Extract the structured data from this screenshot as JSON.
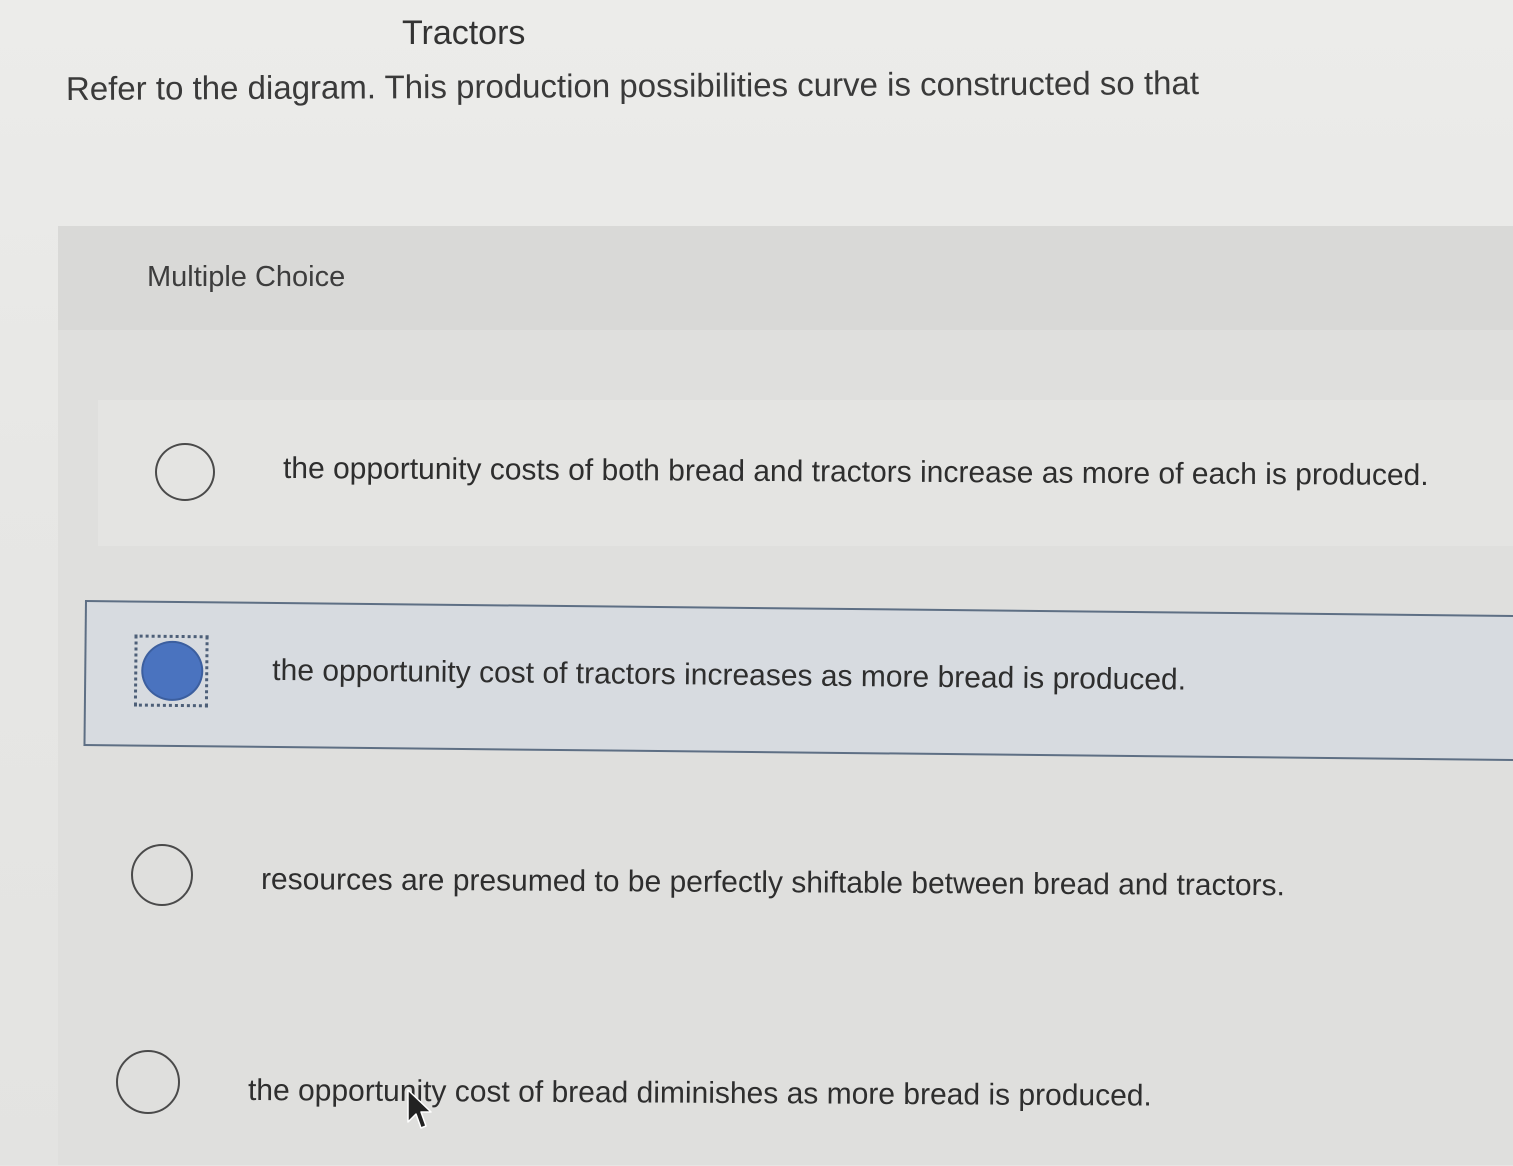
{
  "diagram": {
    "label": "Tractors"
  },
  "question": {
    "text": "Refer to the diagram. This production possibilities curve is constructed so that"
  },
  "multiple_choice": {
    "title": "Multiple Choice",
    "selected_index": 1,
    "options": [
      {
        "label": "the opportunity costs of both bread and tractors increase as more of each is produced.",
        "selected": false
      },
      {
        "label": "the opportunity cost of tractors increases as more bread is produced.",
        "selected": true
      },
      {
        "label": "resources are presumed to be perfectly shiftable between bread and tractors.",
        "selected": false
      },
      {
        "label": "the opportunity cost of bread diminishes as more bread is produced.",
        "selected": false
      }
    ]
  },
  "colors": {
    "selected_fill": "#4a73bf",
    "selected_row_bg": "#d7dbe0",
    "selected_row_border": "#5e6f84"
  },
  "cursor": {
    "icon": "mouse-pointer-icon"
  }
}
